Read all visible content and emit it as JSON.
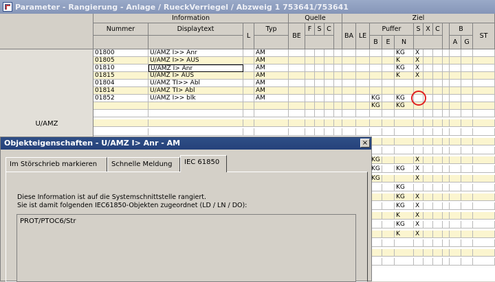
{
  "window": {
    "title": "Parameter - Rangierung - Anlage / RueckVerriegel / Abzweig 1 753641/753641"
  },
  "header": {
    "groups": {
      "information": "Information",
      "quelle": "Quelle",
      "ziel": "Ziel"
    },
    "columns": {
      "nummer": "Nummer",
      "displaytext": "Displaytext",
      "l": "L",
      "typ": "Typ",
      "be": "BE",
      "f": "F",
      "s": "S",
      "c": "C",
      "ba": "BA",
      "le": "LE",
      "puffer": "Puffer",
      "b": "B",
      "e": "E",
      "n": "N",
      "s2": "S",
      "x": "X",
      "c2": "C",
      "bb": "B",
      "st": "ST",
      "a": "A",
      "g": "G"
    }
  },
  "group_label": "U/AMZ",
  "rows": [
    {
      "nummer": "01800",
      "text": "U/AMZ I>> Anr",
      "typ": "AM",
      "b": "",
      "n": "KG",
      "s": "X"
    },
    {
      "nummer": "01805",
      "text": "U/AMZ I>> AUS",
      "typ": "AM",
      "b": "",
      "n": "K",
      "s": "X"
    },
    {
      "nummer": "01810",
      "text": "U/AMZ I> Anr",
      "typ": "AM",
      "b": "",
      "n": "KG",
      "s": "X"
    },
    {
      "nummer": "01815",
      "text": "U/AMZ I> AUS",
      "typ": "AM",
      "b": "",
      "n": "K",
      "s": "X"
    },
    {
      "nummer": "01804",
      "text": "U/AMZ TI>> Abl",
      "typ": "AM",
      "b": "",
      "n": "",
      "s": ""
    },
    {
      "nummer": "01814",
      "text": "U/AMZ TI> Abl",
      "typ": "AM",
      "b": "",
      "n": "",
      "s": ""
    },
    {
      "nummer": "01852",
      "text": "U/AMZ I>> blk",
      "typ": "AM",
      "b": "KG",
      "n": "KG",
      "s": ""
    },
    {
      "nummer": "",
      "text": "",
      "typ": "",
      "b": "KG",
      "n": "KG",
      "s": ""
    }
  ],
  "lower_rows": [
    {
      "b": "",
      "n": "",
      "s": ""
    },
    {
      "b": "",
      "n": "",
      "s": ""
    },
    {
      "b": "",
      "n": "",
      "s": ""
    },
    {
      "b": "",
      "n": "",
      "s": ""
    },
    {
      "b": "",
      "n": "",
      "s": ""
    },
    {
      "b": "KG",
      "n": "",
      "s": "X"
    },
    {
      "b": "KG",
      "n": "KG",
      "s": "X"
    },
    {
      "b": "KG",
      "n": "",
      "s": "X"
    },
    {
      "b": "",
      "n": "KG",
      "s": ""
    },
    {
      "b": "",
      "n": "KG",
      "s": "X"
    },
    {
      "b": "",
      "n": "KG",
      "s": "X"
    },
    {
      "b": "",
      "n": "K",
      "s": "X"
    },
    {
      "b": "",
      "n": "KG",
      "s": "X"
    },
    {
      "b": "",
      "n": "K",
      "s": "X"
    },
    {
      "b": "",
      "n": "",
      "s": ""
    },
    {
      "b": "",
      "n": "",
      "s": ""
    },
    {
      "b": "",
      "n": "",
      "s": ""
    }
  ],
  "dialog": {
    "title": "Objekteigenschaften - U/AMZ I> Anr - AM",
    "close_label": "×",
    "tabs": [
      "Im Störschrieb markieren",
      "Schnelle Meldung",
      "IEC 61850"
    ],
    "active_tab": 2,
    "info_line1": "Diese Information ist auf die Systemschnittstelle rangiert.",
    "info_line2": "Sie ist damit folgenden IEC61850-Objekten zugeordnet (LD / LN / DO):",
    "object_path": "PROT/PTOC6/Str"
  }
}
